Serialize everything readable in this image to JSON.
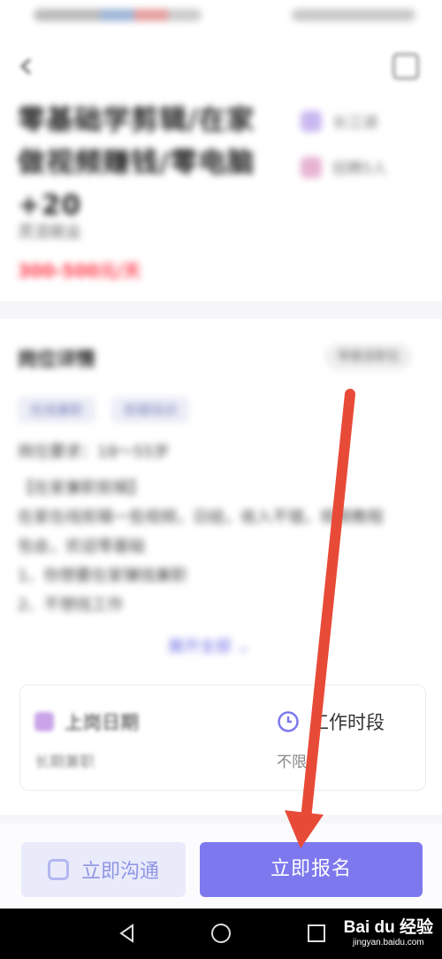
{
  "status_bar": {
    "left": "",
    "right": ""
  },
  "header": {
    "back_icon": "arrow-left-icon",
    "share_icon": "share-icon"
  },
  "job": {
    "title": "零基础学剪辑/在家做视频赚钱/零电脑+20",
    "company": "灵活就业",
    "salary": "300-500元/天",
    "side_info": [
      {
        "label": "长江湖",
        "icon": "location-icon"
      },
      {
        "label": "招聘5人",
        "icon": "person-icon"
      }
    ]
  },
  "details": {
    "title": "岗位详情",
    "report_label": "举报该职位",
    "tags": [
      "在线兼职",
      "剪辑培训"
    ],
    "lines": [
      "岗位要求：18～55岁",
      "【在家兼职剪辑】",
      "在家在线剪辑一些视频，日结，收入不错，视频教程",
      "包会，欢迎零基础",
      "1、你想要在家赚钱兼职",
      "2、不想找工作"
    ],
    "expand_label": "展开全部"
  },
  "schedule": {
    "start_date_label": "上岗日期",
    "start_date_value": "长期兼职",
    "work_time_label": "工作时段",
    "work_time_value": "不限"
  },
  "actions": {
    "chat_label": "立即沟通",
    "apply_label": "立即报名"
  },
  "watermark": {
    "logo": "Bai du 经验",
    "url": "jingyan.baidu.com"
  },
  "colors": {
    "accent": "#7d78ee",
    "salary": "#ff3a4a",
    "arrow": "#e84a38"
  }
}
